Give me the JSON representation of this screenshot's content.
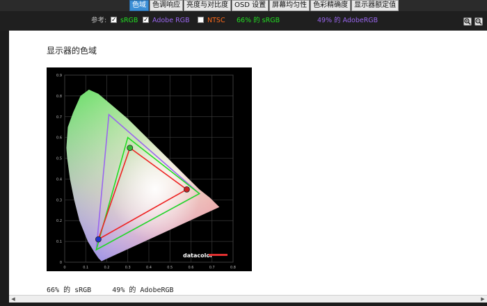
{
  "tabs": [
    {
      "label": "色域",
      "active": true
    },
    {
      "label": "色调响应",
      "active": false
    },
    {
      "label": "亮度与对比度",
      "active": false
    },
    {
      "label": "OSD 设置",
      "active": false
    },
    {
      "label": "屏幕均匀性",
      "active": false
    },
    {
      "label": "色彩精确度",
      "active": false
    },
    {
      "label": "显示器额定值",
      "active": false
    }
  ],
  "toolbar": {
    "reference_label": "参考:",
    "srgb_label": "sRGB",
    "srgb_checked": true,
    "adobe_label": "Adobe RGB",
    "adobe_checked": true,
    "ntsc_label": "NTSC",
    "ntsc_checked": false,
    "srgb_coverage": "66% 的 sRGB",
    "adobe_coverage": "49% 的 AdobeRGB",
    "zoom_in_icon": "zoom-in-icon",
    "zoom_out_icon": "zoom-out-icon"
  },
  "content": {
    "heading": "显示器的色域",
    "caption": "66% 的 sRGB     49% 的 AdobeRGB"
  },
  "chart_data": {
    "type": "scatter",
    "title": "",
    "xlabel": "",
    "ylabel": "",
    "xlim": [
      0,
      0.8
    ],
    "ylim": [
      0,
      0.9
    ],
    "x_ticks": [
      "0",
      "0.1",
      "0.2",
      "0.3",
      "0.4",
      "0.5",
      "0.6",
      "0.7",
      "0.8"
    ],
    "y_ticks": [
      "0",
      "0.1",
      "0.2",
      "0.3",
      "0.4",
      "0.5",
      "0.6",
      "0.7",
      "0.8",
      "0.9"
    ],
    "grid": true,
    "logo_text": "datacolor",
    "series": [
      {
        "name": "Adobe RGB",
        "color": "#9966ee",
        "points": [
          [
            0.64,
            0.33
          ],
          [
            0.21,
            0.71
          ],
          [
            0.15,
            0.06
          ]
        ]
      },
      {
        "name": "sRGB",
        "color": "#22dd22",
        "points": [
          [
            0.64,
            0.33
          ],
          [
            0.3,
            0.6
          ],
          [
            0.15,
            0.06
          ]
        ]
      },
      {
        "name": "",
        "color": "#ee2222",
        "points": [
          [
            0.58,
            0.35
          ],
          [
            0.31,
            0.55
          ],
          [
            0.16,
            0.11
          ]
        ]
      }
    ],
    "primaries": [
      {
        "color": "#cc2222",
        "x": 0.58,
        "y": 0.35
      },
      {
        "color": "#33bb33",
        "x": 0.31,
        "y": 0.55
      },
      {
        "color": "#2233cc",
        "x": 0.16,
        "y": 0.11
      }
    ]
  },
  "colors": {
    "active_tab": "#3c8fd6",
    "srgb": "#22dd22",
    "adobe": "#9966ee",
    "ntsc": "#ff6a1a",
    "reference_text": "#bbbbbb"
  }
}
